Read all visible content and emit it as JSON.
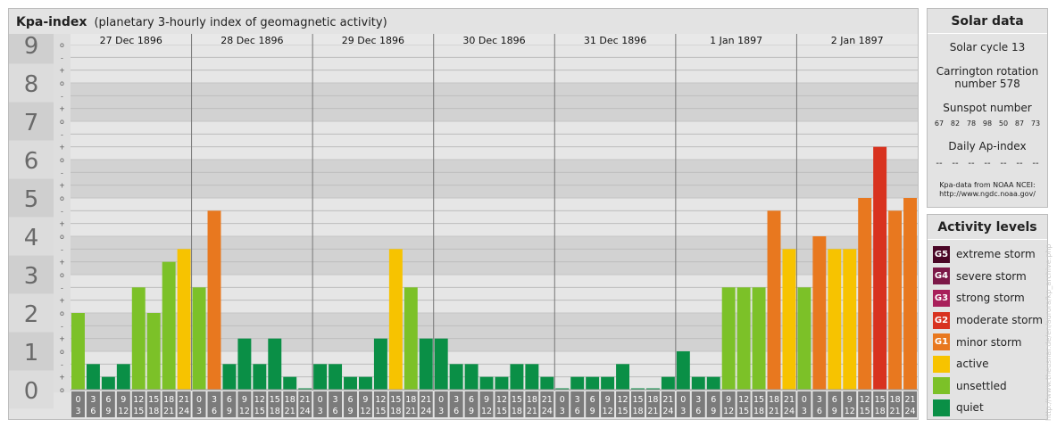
{
  "chart_data": {
    "type": "bar",
    "title": "Kpa-index",
    "subtitle": "(planetary 3-hourly index of geomagnetic activity)",
    "y_axis": {
      "range": [
        0,
        9
      ],
      "major_ticks": [
        "0",
        "1",
        "2",
        "3",
        "4",
        "5",
        "6",
        "7",
        "8",
        "9"
      ],
      "minor_tick_symbols": [
        "o",
        "+",
        "-"
      ]
    },
    "days": [
      "27 Dec 1896",
      "28 Dec 1896",
      "29 Dec 1896",
      "30 Dec 1896",
      "31 Dec 1896",
      "1 Jan 1897",
      "2 Jan 1897"
    ],
    "interval_labels": [
      [
        "0",
        "3"
      ],
      [
        "3",
        "6"
      ],
      [
        "6",
        "9"
      ],
      [
        "9",
        "12"
      ],
      [
        "12",
        "15"
      ],
      [
        "15",
        "18"
      ],
      [
        "18",
        "21"
      ],
      [
        "21",
        "24"
      ]
    ],
    "values": [
      2.0,
      0.667,
      0.333,
      0.667,
      2.667,
      2.0,
      3.333,
      3.667,
      2.667,
      4.667,
      0.667,
      1.333,
      0.667,
      1.333,
      0.333,
      0.0,
      0.667,
      0.667,
      0.333,
      0.333,
      1.333,
      3.667,
      2.667,
      1.333,
      1.333,
      0.667,
      0.667,
      0.333,
      0.333,
      0.667,
      0.667,
      0.333,
      0.0,
      0.333,
      0.333,
      0.333,
      0.667,
      0.0,
      0.0,
      0.333,
      1.0,
      0.333,
      0.333,
      2.667,
      2.667,
      2.667,
      4.667,
      3.667,
      2.667,
      4.0,
      3.667,
      3.667,
      5.0,
      6.333,
      4.667,
      5.0
    ],
    "grid": true
  },
  "colors": {
    "quiet": "#0a8f46",
    "unsettled": "#7cc128",
    "active": "#f7c300",
    "minor_storm": "#e8781f",
    "moderate_storm": "#d8321f",
    "strong_storm": "#a81f5a",
    "severe_storm": "#7c1848",
    "extreme_storm": "#4a0626"
  },
  "solar": {
    "title": "Solar data",
    "cycle": "Solar cycle 13",
    "carrington": "Carrington rotation number 578",
    "sunspot_title": "Sunspot number",
    "sunspot_values": [
      "67",
      "82",
      "78",
      "98",
      "50",
      "87",
      "73"
    ],
    "ap_title": "Daily Ap-index",
    "ap_values": [
      "--",
      "--",
      "--",
      "--",
      "--",
      "--",
      "--"
    ],
    "source_line1": "Kpa-data from NOAA NCEI:",
    "source_line2": "http://www.ngdc.noaa.gov/"
  },
  "levels": {
    "title": "Activity levels",
    "items": [
      {
        "badge": "G5",
        "label": "extreme storm",
        "color": "#4a0626"
      },
      {
        "badge": "G4",
        "label": "severe storm",
        "color": "#7c1848"
      },
      {
        "badge": "G3",
        "label": "strong storm",
        "color": "#a81f5a"
      },
      {
        "badge": "G2",
        "label": "moderate storm",
        "color": "#d8321f"
      },
      {
        "badge": "G1",
        "label": "minor storm",
        "color": "#e8781f"
      },
      {
        "badge": "",
        "label": "active",
        "color": "#f7c300"
      },
      {
        "badge": "",
        "label": "unsettled",
        "color": "#7cc128"
      },
      {
        "badge": "",
        "label": "quiet",
        "color": "#0a8f46"
      }
    ]
  },
  "watermark": "http://www.theusnar.de/en/aurora/kp_archive.php"
}
